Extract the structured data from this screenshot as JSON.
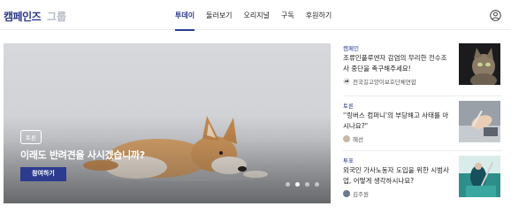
{
  "header": {
    "logo": "캠페인즈",
    "logo_sub": "그룹",
    "nav": [
      "투데이",
      "둘러보기",
      "오리지널",
      "구독",
      "후원하기"
    ],
    "active_index": 0,
    "user_icon": "user-circle-icon"
  },
  "hero": {
    "tag": "토론",
    "title": "이래도 반려견을 사시겠습니까?",
    "button": "참여하기",
    "slide_count": 4,
    "active_slide": 1
  },
  "side": [
    {
      "category": "캠페인",
      "title": "조류인플루엔자 감염의 무리한 전수조사 중단을 촉구해주세요!",
      "author": "전국길고양이보호단체연합"
    },
    {
      "category": "토론",
      "title": "''링버스 컴퍼니'의 부당해고 사태를 아시나요?\"",
      "author": "혜선"
    },
    {
      "category": "투표",
      "title": "외국인 가사노동자 도입을 위한 시범사업, 어떻게 생각하시나요?",
      "author": "김주원"
    }
  ]
}
